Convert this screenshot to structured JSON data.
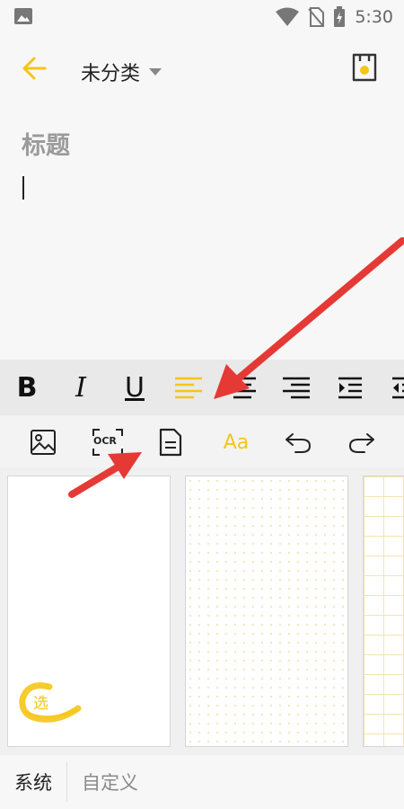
{
  "status_bar": {
    "time": "5:30",
    "icons": [
      "image-notification-icon",
      "wifi-icon",
      "no-sim-icon",
      "battery-charging-icon"
    ]
  },
  "app_bar": {
    "category_label": "未分类",
    "back_icon": "arrow-left-icon",
    "save_icon": "save-icon"
  },
  "editor": {
    "title_placeholder": "标题"
  },
  "format_bar": {
    "bold_label": "B",
    "italic_label": "I",
    "underline_label": "U",
    "items": [
      "bold",
      "italic",
      "underline",
      "align-left",
      "align-center",
      "align-right",
      "indent",
      "outdent"
    ]
  },
  "tool_bar": {
    "ocr_label": "OCR",
    "font_label": "Aa",
    "items": [
      "image",
      "ocr",
      "template",
      "font",
      "undo",
      "redo"
    ]
  },
  "templates": {
    "items": [
      "blank-with-logo",
      "dotted",
      "grid"
    ],
    "logo_char": "选"
  },
  "bottom_tabs": {
    "system_label": "系统",
    "custom_label": "自定义"
  },
  "colors": {
    "accent": "#f5c518",
    "arrow": "#e53935",
    "toolbar": "#e9e9e9",
    "background": "#f7f7f7"
  }
}
